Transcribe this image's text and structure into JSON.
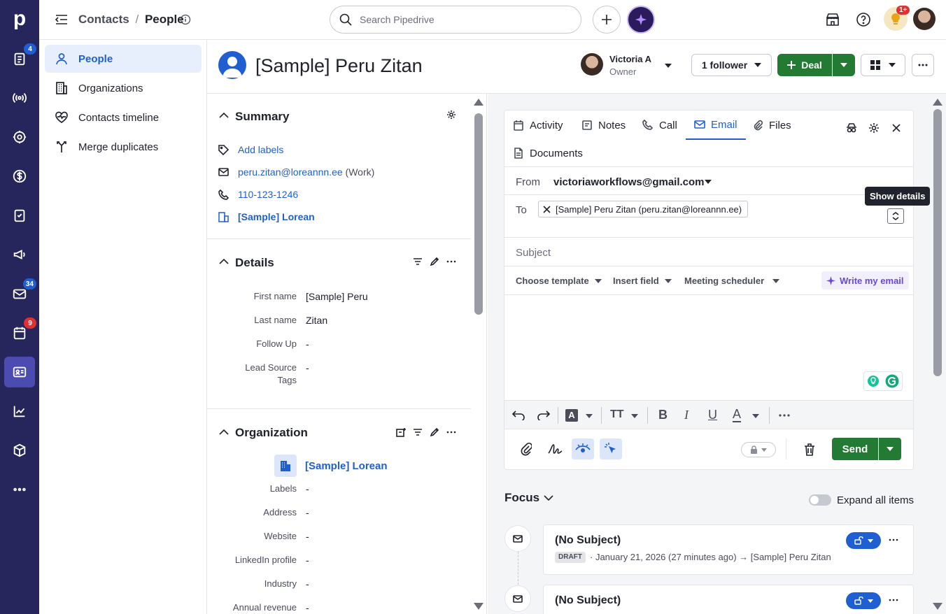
{
  "rail": {
    "logo": "p",
    "badges": {
      "deals": "4",
      "mail": "34",
      "calendar": "9"
    }
  },
  "topbar": {
    "breadcrumb_parent": "Contacts",
    "breadcrumb_sep": "/",
    "breadcrumb_current": "People",
    "search_placeholder": "Search Pipedrive",
    "notif_badge": "1+"
  },
  "sidebar": {
    "items": [
      {
        "label": "People"
      },
      {
        "label": "Organizations"
      },
      {
        "label": "Contacts timeline"
      },
      {
        "label": "Merge duplicates"
      }
    ]
  },
  "header": {
    "person_name": "[Sample] Peru Zitan",
    "owner_name": "Victoria A",
    "owner_role": "Owner",
    "follower_label": "1 follower",
    "deal_label": "Deal"
  },
  "summary": {
    "title": "Summary",
    "add_labels": "Add labels",
    "email": "peru.zitan@loreannn.ee",
    "email_type": "(Work)",
    "phone": "110-123-1246",
    "org": "[Sample] Lorean"
  },
  "details": {
    "title": "Details",
    "fields": [
      {
        "label": "First name",
        "value": "[Sample] Peru"
      },
      {
        "label": "Last name",
        "value": "Zitan"
      },
      {
        "label": "Follow Up",
        "value": "-"
      },
      {
        "label": "Lead Source",
        "label2": "Tags",
        "value": "-"
      }
    ]
  },
  "organization": {
    "title": "Organization",
    "name": "[Sample] Lorean",
    "fields": [
      {
        "label": "Labels",
        "value": "-"
      },
      {
        "label": "Address",
        "value": "-"
      },
      {
        "label": "Website",
        "value": "-"
      },
      {
        "label": "LinkedIn profile",
        "value": "-"
      },
      {
        "label": "Industry",
        "value": "-"
      },
      {
        "label": "Annual revenue",
        "value": "-"
      }
    ]
  },
  "composer": {
    "tabs": [
      {
        "label": "Activity"
      },
      {
        "label": "Notes"
      },
      {
        "label": "Call"
      },
      {
        "label": "Email"
      },
      {
        "label": "Files"
      },
      {
        "label": "Documents"
      }
    ],
    "from_label": "From",
    "from_value": "victoriaworkflows@gmail.com",
    "to_label": "To",
    "to_chip": "[Sample] Peru Zitan (peru.zitan@loreannn.ee)",
    "tooltip": "Show details",
    "subject_placeholder": "Subject",
    "choose_template": "Choose template",
    "insert_field": "Insert field",
    "meeting_scheduler": "Meeting scheduler",
    "write_my_email": "Write my email",
    "send_label": "Send"
  },
  "focus": {
    "title": "Focus",
    "expand_label": "Expand all items",
    "items": [
      {
        "subject": "(No Subject)",
        "badge": "DRAFT",
        "meta": "· January 21, 2026 (27 minutes ago) → [Sample] Peru Zitan"
      },
      {
        "subject": "(No Subject)"
      }
    ]
  },
  "colors": {
    "rail": "#26255c",
    "accent": "#1f5fd1",
    "green": "#237a33"
  }
}
